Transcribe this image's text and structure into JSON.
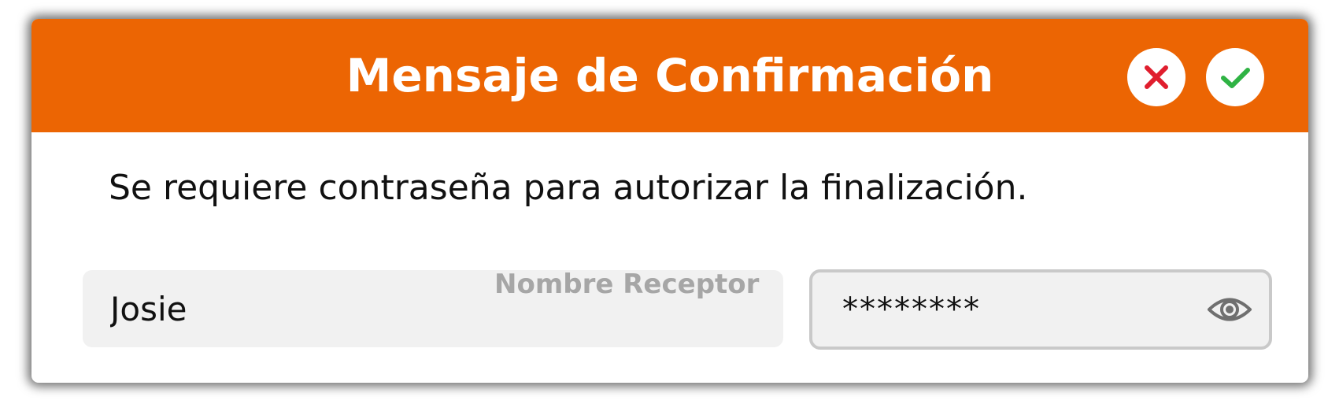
{
  "dialog": {
    "title": "Mensaje de Confirmación",
    "message": "Se requiere contraseña para autorizar la finalización.",
    "cancel_icon": "close-icon",
    "confirm_icon": "check-icon"
  },
  "form": {
    "receiver": {
      "label": "Nombre Receptor",
      "value": "Josie"
    },
    "password": {
      "value": "********",
      "toggle_icon": "eye-icon"
    }
  },
  "colors": {
    "header": "#ec6503",
    "cancel": "#e01e2e",
    "confirm": "#2fb344",
    "label": "#a6a6a6",
    "field_bg": "#f1f1f1"
  }
}
